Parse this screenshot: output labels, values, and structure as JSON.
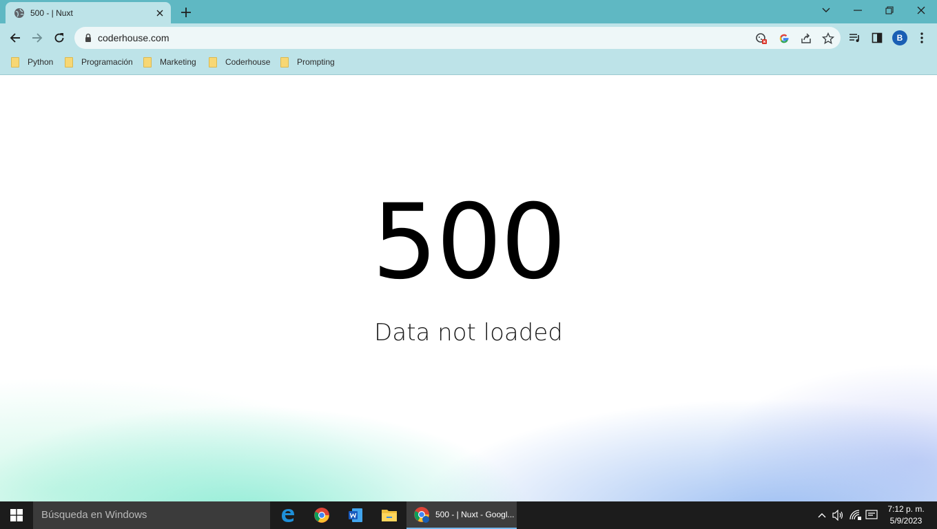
{
  "browser": {
    "tab": {
      "title": "500 - | Nuxt"
    },
    "address": {
      "url": "coderhouse.com"
    },
    "profile_initial": "B",
    "bookmarks": [
      {
        "label": "Python"
      },
      {
        "label": "Programación"
      },
      {
        "label": "Marketing"
      },
      {
        "label": "Coderhouse"
      },
      {
        "label": "Prompting"
      }
    ]
  },
  "page": {
    "error_code": "500",
    "error_message": "Data not loaded"
  },
  "taskbar": {
    "search_placeholder": "Búsqueda en Windows",
    "active_window_label": "500 - | Nuxt - Googl...",
    "clock": {
      "time": "7:12 p. m.",
      "date": "5/9/2023"
    },
    "apps": [
      "edge-icon",
      "chrome-icon",
      "word-icon",
      "file-explorer-icon"
    ]
  },
  "colors": {
    "tabstrip": "#5fb8c3",
    "toolbar": "#bde3e8",
    "avatar": "#1a5fb4",
    "taskbar": "#1c1c1c"
  }
}
